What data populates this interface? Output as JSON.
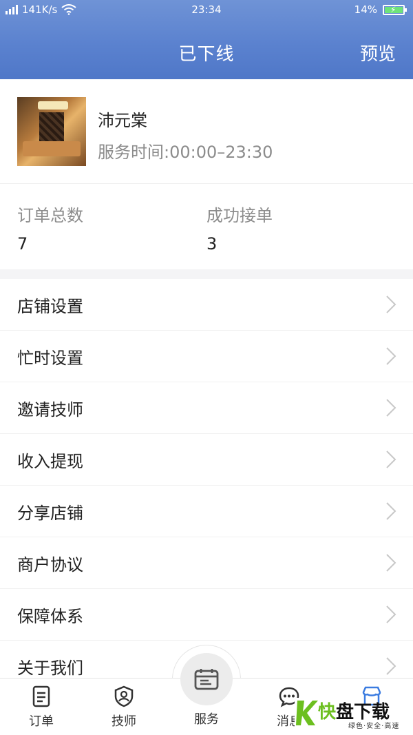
{
  "status_bar": {
    "network": "141K/s",
    "time": "23:34",
    "battery": "14%"
  },
  "header": {
    "title": "已下线",
    "preview_label": "预览"
  },
  "shop": {
    "name": "沛元棠",
    "hours": "服务时间:00:00–23:30"
  },
  "stats": [
    {
      "label": "订单总数",
      "value": "7"
    },
    {
      "label": "成功接单",
      "value": "3"
    }
  ],
  "menu": [
    {
      "label": "店铺设置"
    },
    {
      "label": "忙时设置"
    },
    {
      "label": "邀请技师"
    },
    {
      "label": "收入提现"
    },
    {
      "label": "分享店铺"
    },
    {
      "label": "商户协议"
    },
    {
      "label": "保障体系"
    },
    {
      "label": "关于我们"
    }
  ],
  "tabs": {
    "orders": "订单",
    "techs": "技师",
    "service": "服务",
    "messages": "消息"
  },
  "watermark": {
    "main_a": "快",
    "main_b": "盘下载",
    "sub": "绿色·安全·高速"
  },
  "colors": {
    "header": "#5b82cf",
    "divider": "#f4f4f6",
    "watermark_green": "#6cbf1f"
  }
}
